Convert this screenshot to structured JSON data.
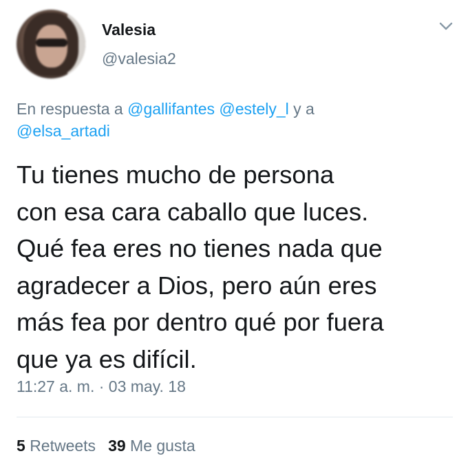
{
  "user": {
    "name": "Valesia",
    "handle": "@valesia2",
    "avatar_icon": "user-avatar-blurred"
  },
  "menu": {
    "icon": "chevron-down-icon"
  },
  "reply_context": {
    "prefix": "En respuesta a",
    "mentions": [
      "@gallifantes",
      "@estely_l",
      "@elsa_artadi"
    ],
    "connector": "y a"
  },
  "tweet": {
    "lines": [
      "Tu tienes mucho de persona",
      "con esa cara caballo que luces.",
      "Qué fea eres no tienes nada que",
      "agradecer a Dios, pero aún eres",
      "más fea por dentro qué por fuera",
      "que ya es difícil."
    ],
    "timestamp": "11:27 a. m. · 03 may. 18"
  },
  "stats": {
    "retweets_count": "5",
    "retweets_label": "Retweets",
    "likes_count": "39",
    "likes_label": "Me gusta"
  },
  "colors": {
    "text": "#14171a",
    "secondary": "#657786",
    "link": "#1da1f2",
    "divider": "#e1e8ed"
  }
}
